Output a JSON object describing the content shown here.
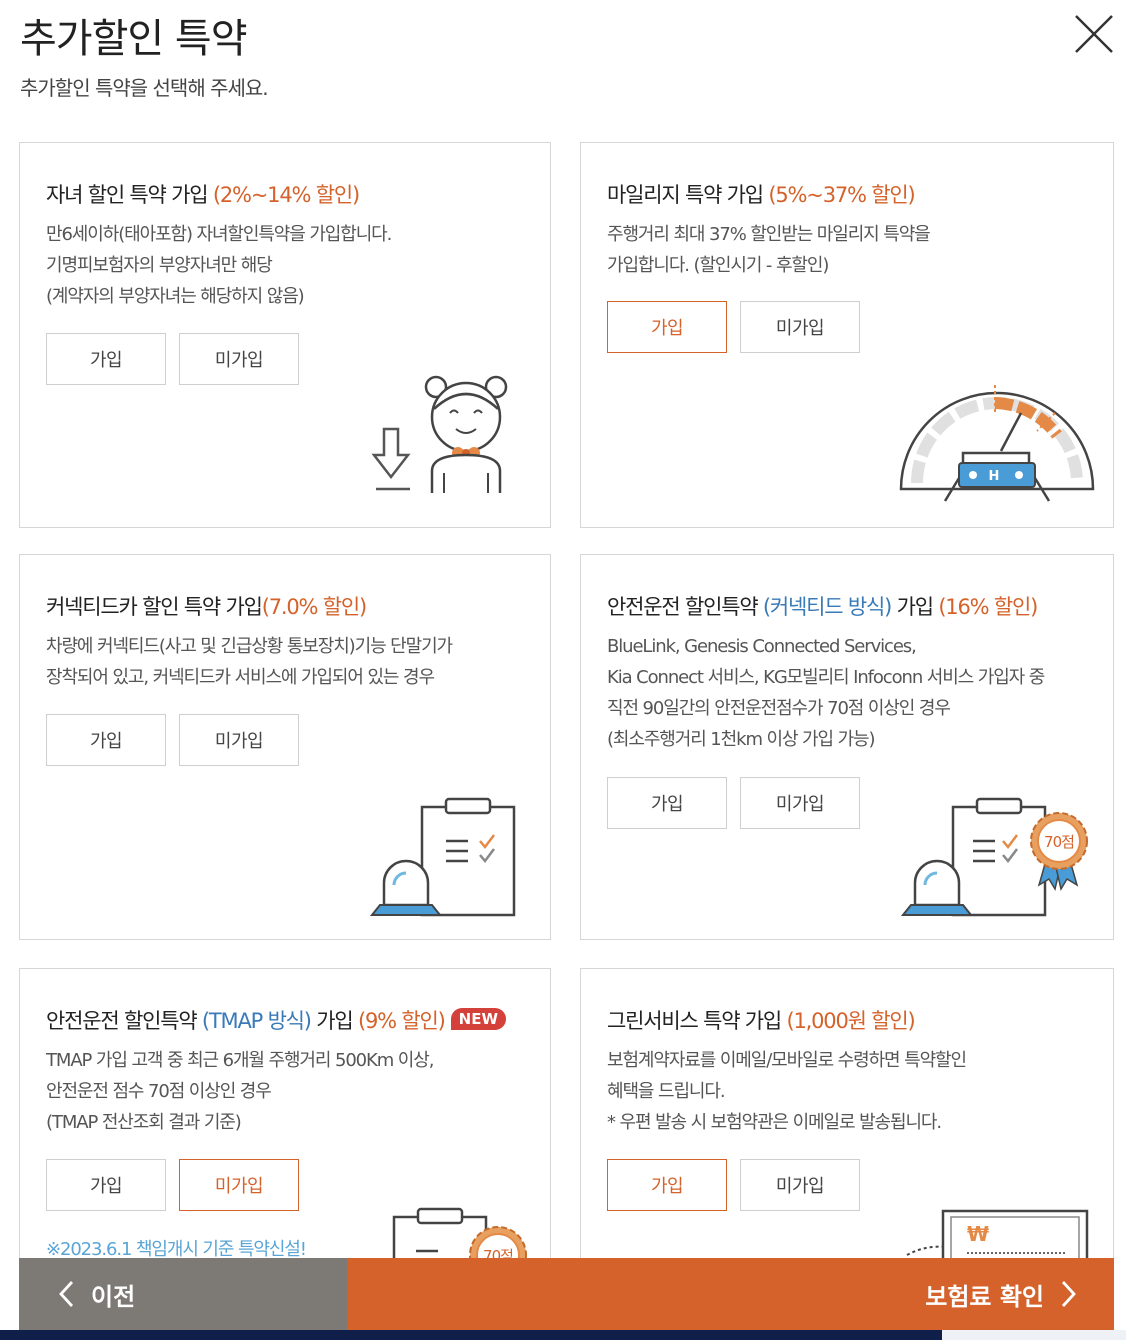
{
  "header": {
    "title": "추가할인 특약",
    "subtitle": "추가할인 특약을 선택해 주세요.",
    "close_icon": "close-icon"
  },
  "cards": [
    {
      "title": "자녀 할인 특약 가입 ",
      "highlight": "(2%~14% 할인)",
      "desc": [
        "만6세이하(태아포함) 자녀할인특약을 가입합니다.",
        "기명피보험자의 부양자녀만 해당",
        "(계약자의 부양자녀는 해당하지 않음)"
      ],
      "join_label": "가입",
      "nojoin_label": "미가입",
      "selected": "none",
      "icon": "child-icon"
    },
    {
      "title": "마일리지 특약 가입 ",
      "highlight": "(5%~37% 할인)",
      "desc": [
        "주행거리 최대 37% 할인받는 마일리지 특약을",
        "가입합니다. (할인시기 - 후할인)"
      ],
      "join_label": "가입",
      "nojoin_label": "미가입",
      "selected": "join",
      "icon": "odometer-car-icon"
    },
    {
      "title": "커넥티드카 할인 특약 가입",
      "highlight": "(7.0% 할인)",
      "desc": [
        "차량에 커넥티드(사고 및 긴급상황 통보장치)기능 단말기가",
        "장착되어 있고, 커넥티드카 서비스에 가입되어 있는 경우"
      ],
      "join_label": "가입",
      "nojoin_label": "미가입",
      "selected": "none",
      "icon": "clipboard-siren-icon"
    },
    {
      "title": "안전운전 할인특약 ",
      "blue": "(커넥티드 방식)",
      "title2": " 가입 ",
      "highlight": "(16% 할인)",
      "desc": [
        "BlueLink, Genesis Connected Services,",
        "Kia Connect 서비스, KG모빌리티 Infoconn 서비스 가입자 중",
        "직전 90일간의 안전운전점수가 70점 이상인 경우",
        "(최소주행거리 1천km 이상 가입 가능)"
      ],
      "join_label": "가입",
      "nojoin_label": "미가입",
      "selected": "none",
      "icon": "clipboard-score-badge-icon",
      "badge_text": "70점"
    },
    {
      "title": "안전운전 할인특약 ",
      "blue": "(TMAP 방식)",
      "title2": " 가입 ",
      "highlight": "(9% 할인)",
      "new_badge": "NEW",
      "desc": [
        "TMAP 가입 고객 중 최근 6개월 주행거리 500Km 이상,",
        "안전운전 점수 70점 이상인 경우",
        "(TMAP 전산조회 결과 기준)"
      ],
      "join_label": "가입",
      "nojoin_label": "미가입",
      "selected": "nojoin",
      "notice": "※2023.6.1 책임개시 기준 특약신설!",
      "icon": "clipboard-score-badge-icon",
      "badge_text": "70점"
    },
    {
      "title": "그린서비스 특약 가입 ",
      "highlight": "(1,000원 할인)",
      "desc": [
        "보험계약자료를 이메일/모바일로 수령하면 특약할인",
        "혜택을 드립니다.",
        "* 우편 발송 시 보험약관은 이메일로 발송됩니다."
      ],
      "join_label": "가입",
      "nojoin_label": "미가입",
      "selected": "join",
      "icon": "won-document-icon",
      "won_symbol": "₩"
    }
  ],
  "footer": {
    "prev_label": "이전",
    "next_label": "보험료 확인",
    "prev_icon": "chevron-left-icon",
    "next_icon": "chevron-right-icon"
  },
  "colors": {
    "accent": "#d4622a",
    "blue": "#3a7ab8",
    "prev_bg": "#7d7a75",
    "notice": "#5aa5d6"
  }
}
